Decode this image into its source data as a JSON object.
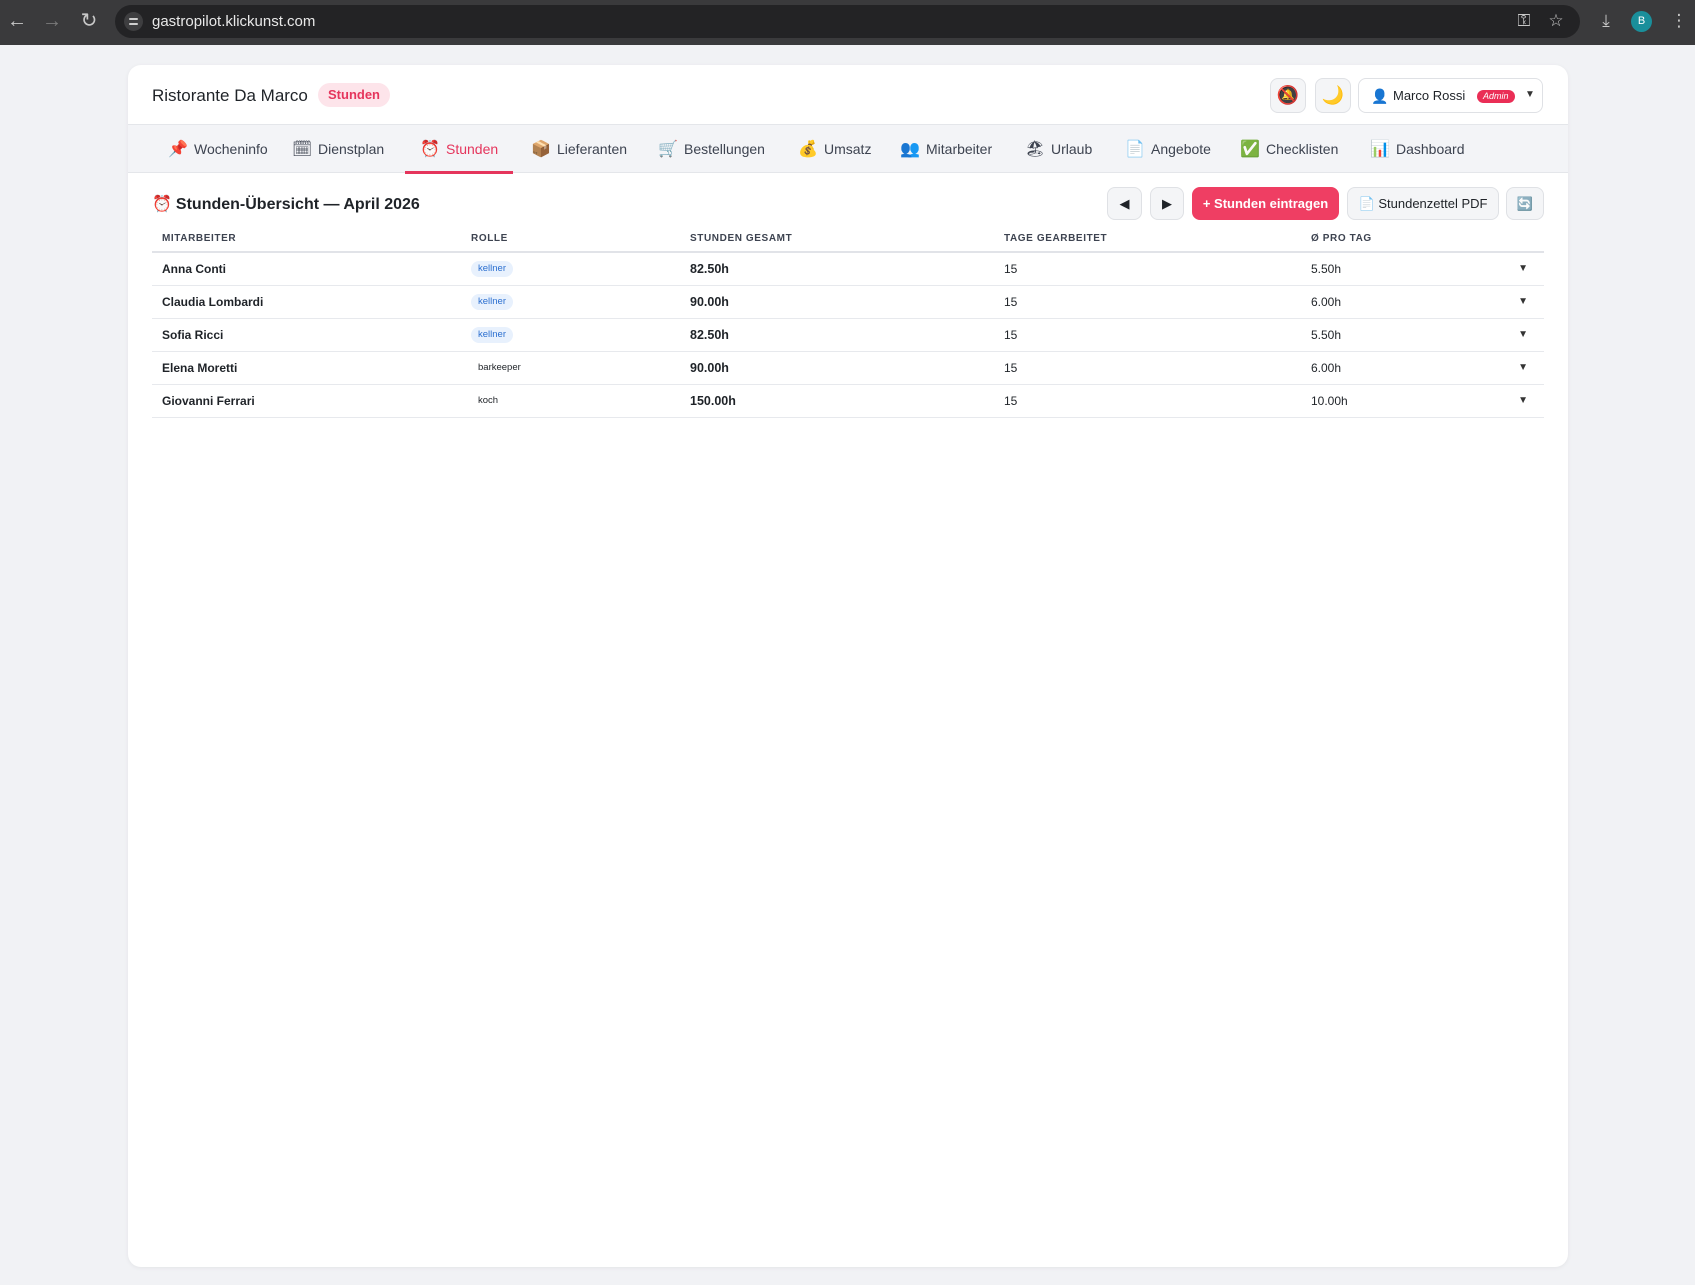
{
  "browser": {
    "url": "gastropilot.klickunst.com",
    "profile_initial": "B"
  },
  "header": {
    "restaurant_name": "Ristorante Da Marco",
    "page_badge": "Stunden",
    "user_name": "Marco Rossi",
    "user_role_badge": "Admin",
    "notification_icon": "🔕",
    "theme_icon": "🌙",
    "user_icon": "👤"
  },
  "tabs": [
    {
      "icon": "📌",
      "label": "Wocheninfo"
    },
    {
      "icon": "🗓",
      "label": "Dienstplan"
    },
    {
      "icon": "⏰",
      "label": "Stunden",
      "active": true
    },
    {
      "icon": "📦",
      "label": "Lieferanten"
    },
    {
      "icon": "🛒",
      "label": "Bestellungen"
    },
    {
      "icon": "💰",
      "label": "Umsatz"
    },
    {
      "icon": "👥",
      "label": "Mitarbeiter"
    },
    {
      "icon": "🏖",
      "label": "Urlaub"
    },
    {
      "icon": "📄",
      "label": "Angebote"
    },
    {
      "icon": "✅",
      "label": "Checklisten"
    },
    {
      "icon": "📊",
      "label": "Dashboard"
    }
  ],
  "overview": {
    "icon": "⏰",
    "title": "Stunden-Übersicht — April 2026",
    "prev_icon": "◀",
    "next_icon": "▶",
    "add_button": "+ Stunden eintragen",
    "pdf_icon": "📄",
    "pdf_button": "Stundenzettel PDF",
    "refresh_icon": "🔄"
  },
  "table": {
    "columns": [
      "MITARBEITER",
      "ROLLE",
      "STUNDEN GESAMT",
      "TAGE GEARBEITET",
      "Ø PRO TAG"
    ],
    "expand_icon": "▼",
    "rows": [
      {
        "name": "Anna Conti",
        "role": "kellner",
        "hours": "82.50h",
        "days": "15",
        "avg": "5.50h"
      },
      {
        "name": "Claudia Lombardi",
        "role": "kellner",
        "hours": "90.00h",
        "days": "15",
        "avg": "6.00h"
      },
      {
        "name": "Sofia Ricci",
        "role": "kellner",
        "hours": "82.50h",
        "days": "15",
        "avg": "5.50h"
      },
      {
        "name": "Elena Moretti",
        "role": "barkeeper",
        "hours": "90.00h",
        "days": "15",
        "avg": "6.00h"
      },
      {
        "name": "Giovanni Ferrari",
        "role": "koch",
        "hours": "150.00h",
        "days": "15",
        "avg": "10.00h"
      }
    ]
  },
  "colors": {
    "accent": "#e5355c",
    "primary_button": "#ef3e63",
    "kellner_badge_bg": "#e8f1fd",
    "kellner_badge_text": "#2b6fd0"
  }
}
